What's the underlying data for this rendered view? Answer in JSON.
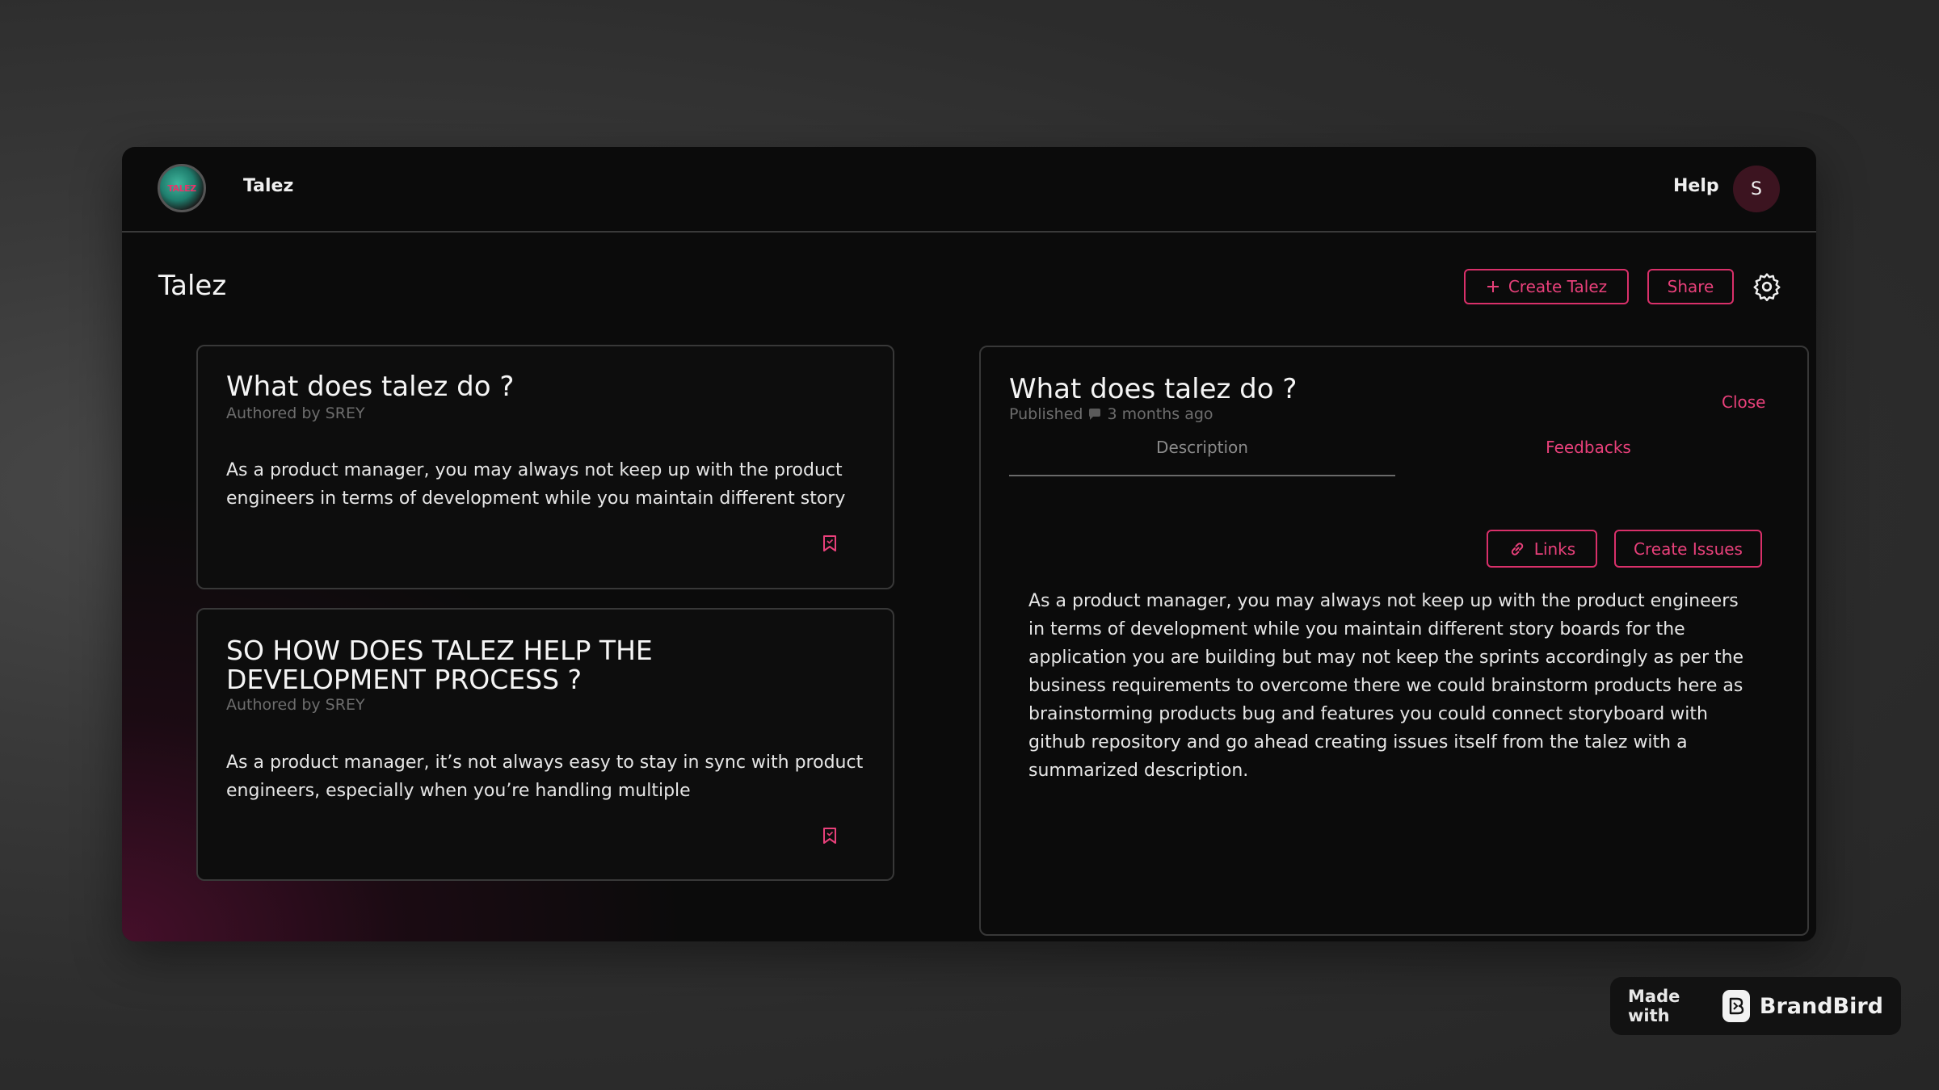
{
  "app": {
    "name": "Talez",
    "logo_text": "TALEZ"
  },
  "header": {
    "help_label": "Help",
    "avatar_initial": "S"
  },
  "page": {
    "title": "Talez"
  },
  "toolbar": {
    "create_label": "Create Talez",
    "share_label": "Share",
    "settings_icon": "gear-icon"
  },
  "cards": [
    {
      "title": "What does talez do ?",
      "author": "Authored by SREY",
      "excerpt": "As a product manager, you may always not keep up with the product engineers in terms of development while you maintain different story"
    },
    {
      "title": "SO HOW DOES TALEZ HELP THE DEVELOPMENT PROCESS ?",
      "author": "Authored by SREY",
      "excerpt": "As a product manager, it’s not always easy to stay in sync with product engineers, especially when you’re handling multiple"
    }
  ],
  "detail": {
    "title": "What does talez do ?",
    "published_label": "Published",
    "published_time": "3 months ago",
    "close_label": "Close",
    "tabs": [
      {
        "label": "Description",
        "active": true
      },
      {
        "label": "Feedbacks",
        "active": false
      }
    ],
    "links_label": "Links",
    "create_issues_label": "Create Issues",
    "body": "As a product manager, you may always not keep up with the product engineers in terms of development while you maintain different story boards for the application you are building but may not keep the sprints accordingly as per the business requirements to overcome there we could brainstorm products here as brainstorming products bug and features you could connect storyboard with github repository and go ahead creating issues itself from the talez with a summarized description."
  },
  "badge": {
    "made_with": "Made with",
    "brand": "BrandBird"
  },
  "colors": {
    "accent": "#e8407a",
    "background": "#0b0b0b",
    "border": "#383838"
  }
}
